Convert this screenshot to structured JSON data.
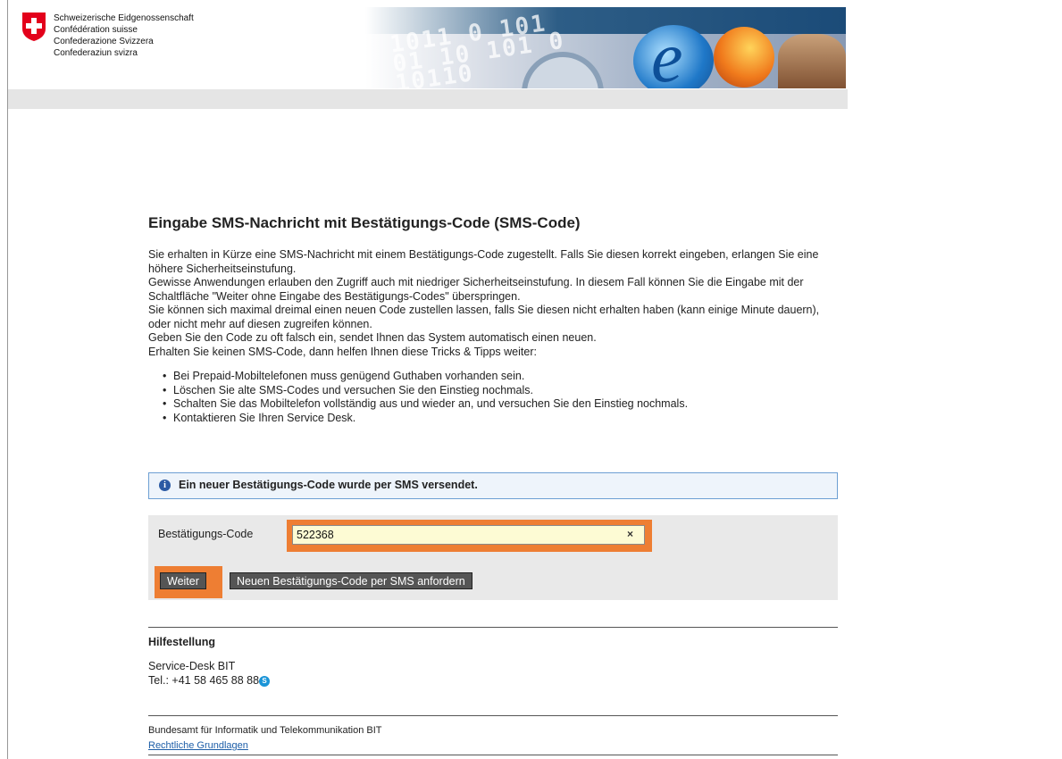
{
  "header": {
    "gov_lines": [
      "Schweizerische Eidgenossenschaft",
      "Confédération suisse",
      "Confederazione Svizzera",
      "Confederaziun svizra"
    ],
    "banner_digits": [
      "1011 0 101",
      "01 10 101 0",
      "10110"
    ],
    "banner_to": "to"
  },
  "main": {
    "title": "Eingabe SMS-Nachricht mit Bestätigungs-Code (SMS-Code)",
    "paragraphs": [
      "Sie erhalten in Kürze eine SMS-Nachricht mit einem Bestätigungs-Code zugestellt. Falls Sie diesen korrekt eingeben, erlangen Sie eine höhere Sicherheitseinstufung.",
      "Gewisse Anwendungen erlauben den Zugriff auch mit niedriger Sicherheitseinstufung. In diesem Fall können Sie die Eingabe mit der Schaltfläche \"Weiter ohne Eingabe des Bestätigungs-Codes\" überspringen.",
      "Sie können sich maximal dreimal einen neuen Code zustellen lassen, falls Sie diesen nicht erhalten haben (kann einige Minute dauern), oder nicht mehr auf diesen zugreifen können.",
      "Geben Sie den Code zu oft falsch ein, sendet Ihnen das System automatisch einen neuen.",
      "Erhalten Sie keinen SMS-Code, dann helfen Ihnen diese Tricks & Tipps weiter:"
    ],
    "tips": [
      "Bei Prepaid-Mobiltelefonen muss genügend Guthaben vorhanden sein.",
      "Löschen Sie alte SMS-Codes und versuchen Sie den Einstieg nochmals.",
      "Schalten Sie das Mobiltelefon vollständig aus und wieder an, und versuchen Sie den Einstieg nochmals.",
      "Kontaktieren Sie Ihren Service Desk."
    ]
  },
  "info": {
    "icon": "i",
    "message": "Ein neuer Bestätigungs-Code wurde per SMS versendet."
  },
  "form": {
    "code_label": "Bestätigungs-Code",
    "code_value": "522368",
    "clear_glyph": "×",
    "weiter_label": "Weiter",
    "resend_label": "Neuen Bestätigungs-Code per SMS anfordern"
  },
  "help": {
    "title": "Hilfestellung",
    "line1": "Service-Desk BIT",
    "phone": "Tel.: +41 58 465 88 88"
  },
  "footer": {
    "org": "Bundesamt für Informatik und Telekommunikation BIT",
    "legal_link": "Rechtliche Grundlagen"
  },
  "colors": {
    "highlight": "#ee7e33",
    "info_border": "#6d9fd3",
    "button_bg": "#555555",
    "swiss_red": "#e3001b"
  }
}
